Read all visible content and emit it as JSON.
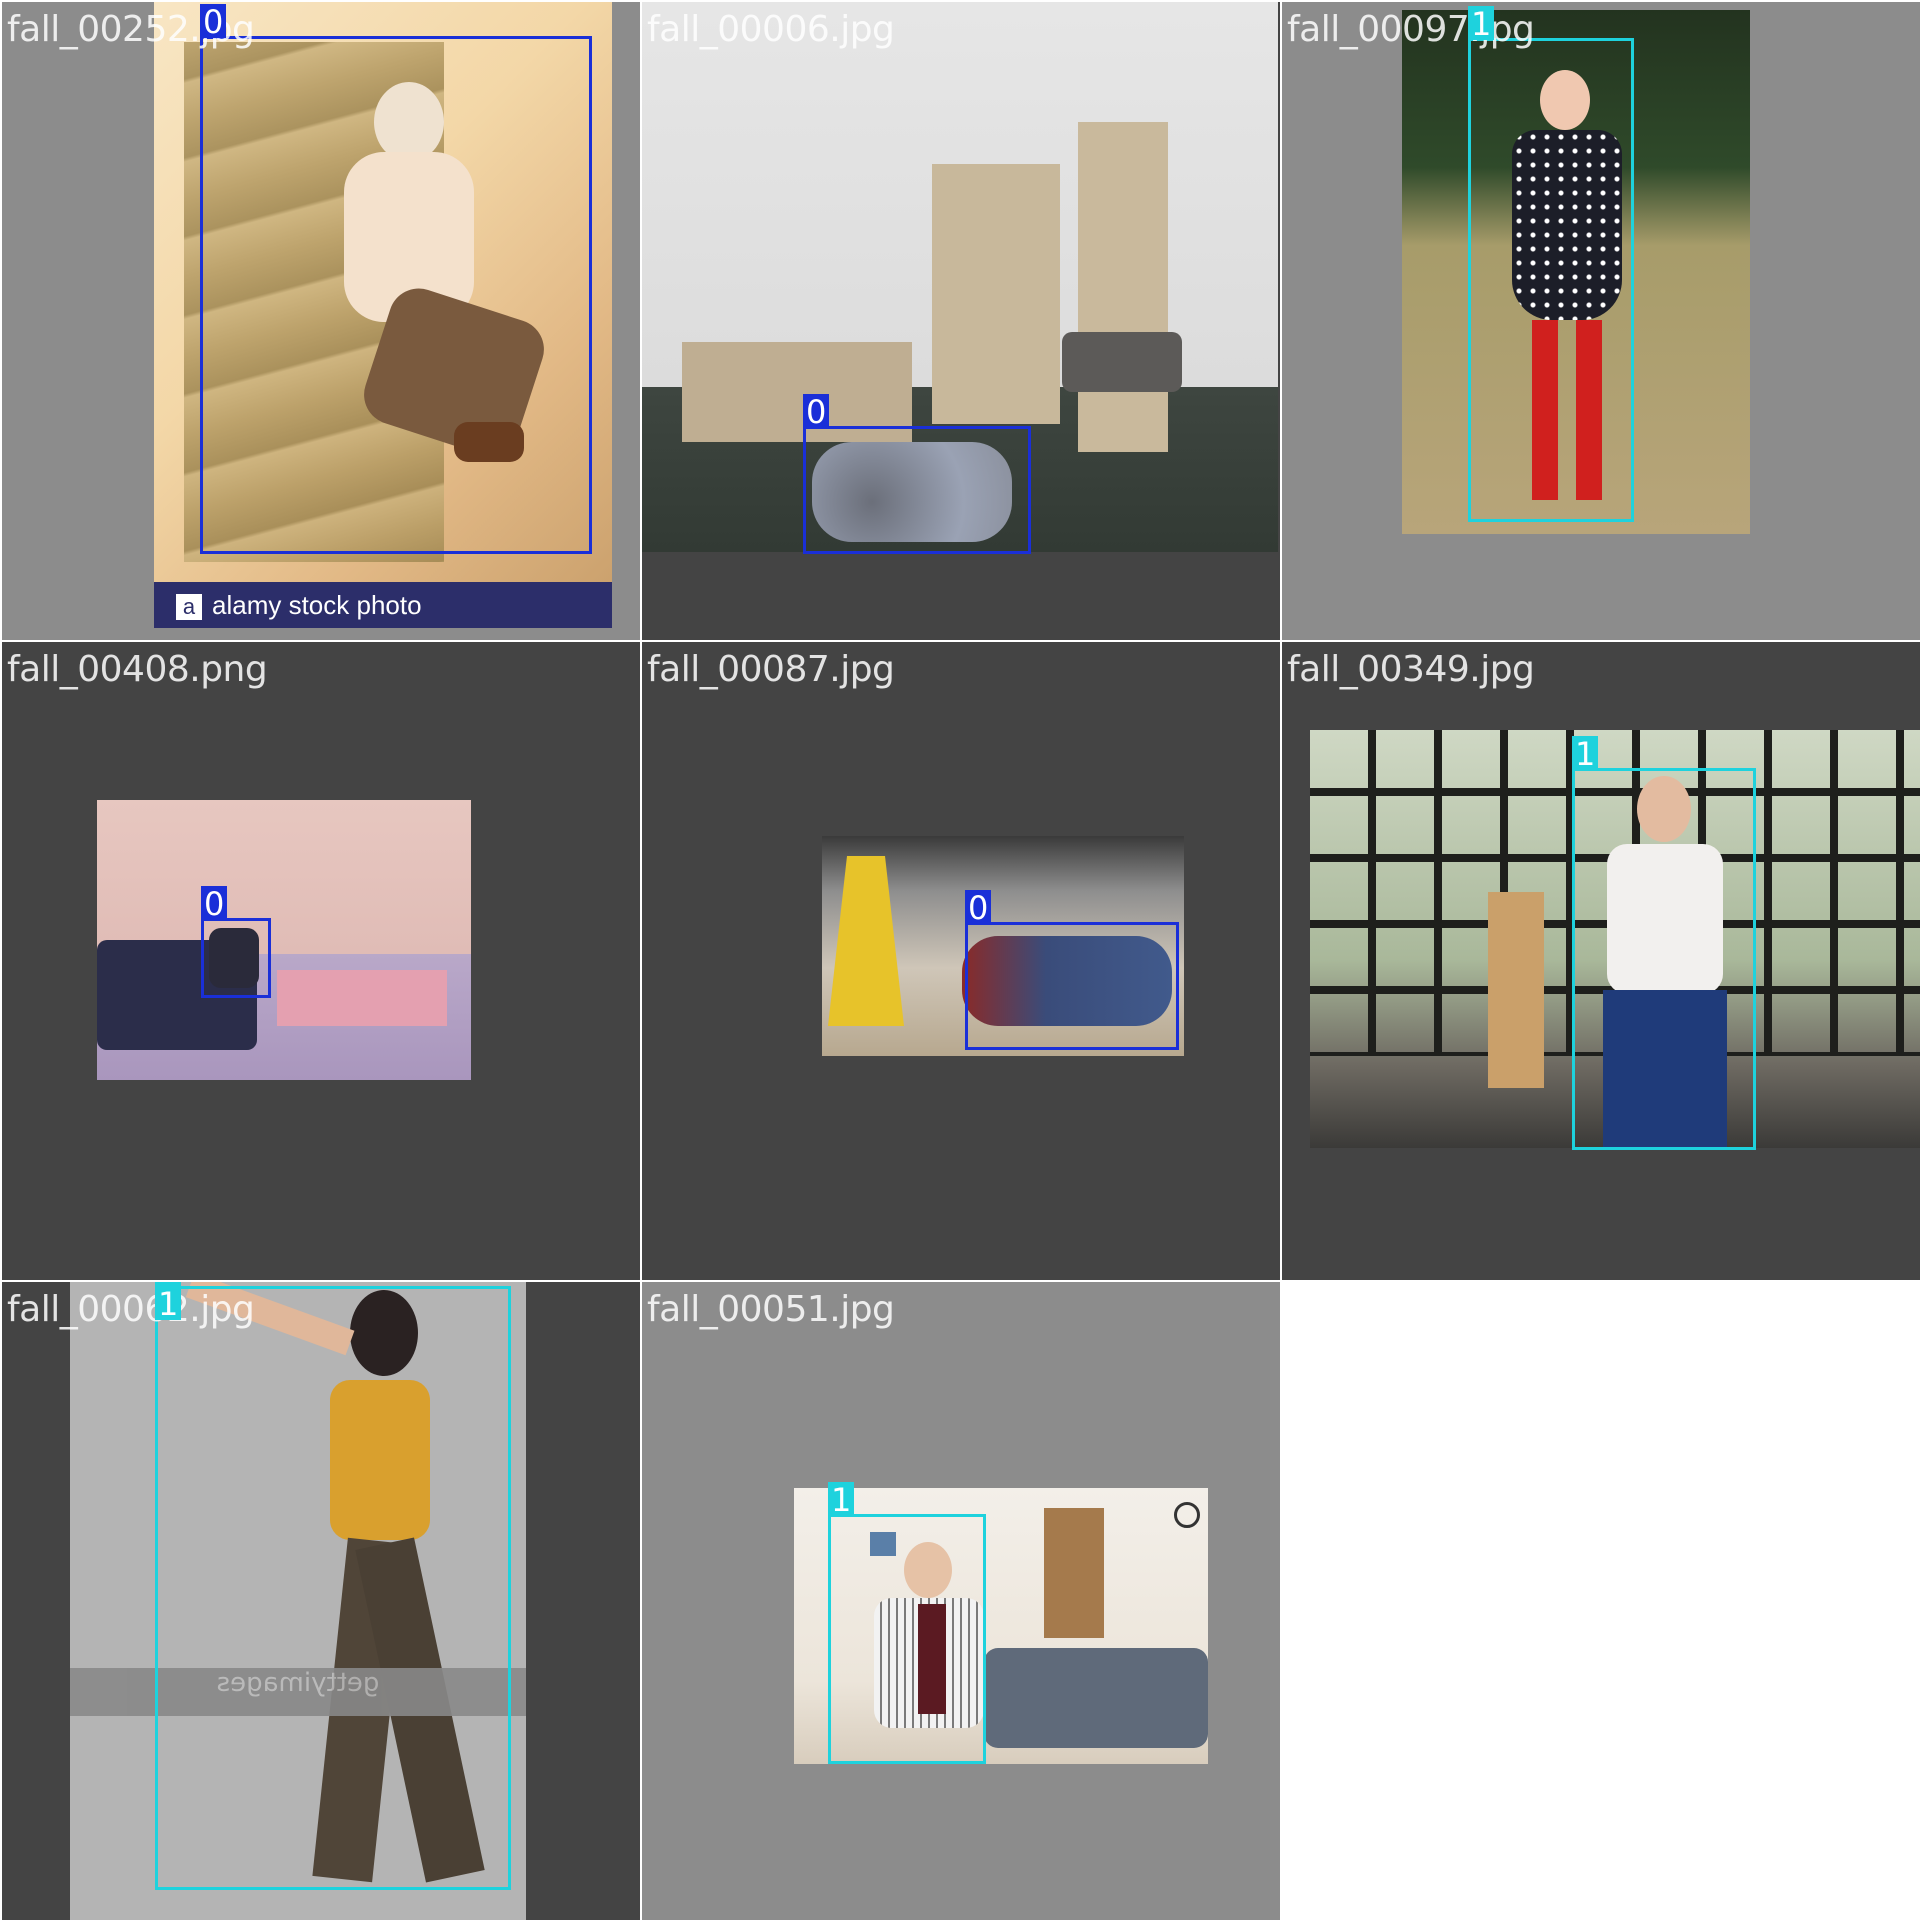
{
  "grid": {
    "tiles": [
      {
        "filename": "fall_00252.jpg",
        "boxes": [
          {
            "class_label": "0"
          }
        ],
        "watermark": "alamy stock photo",
        "watermark_logo": "a"
      },
      {
        "filename": "fall_00006.jpg",
        "boxes": [
          {
            "class_label": "0"
          }
        ]
      },
      {
        "filename": "fall_00097.jpg",
        "boxes": [
          {
            "class_label": "1"
          }
        ]
      },
      {
        "filename": "fall_00408.png",
        "boxes": [
          {
            "class_label": "0"
          }
        ]
      },
      {
        "filename": "fall_00087.jpg",
        "boxes": [
          {
            "class_label": "0"
          }
        ]
      },
      {
        "filename": "fall_00349.jpg",
        "boxes": [
          {
            "class_label": "1"
          }
        ]
      },
      {
        "filename": "fall_00062.jpg",
        "boxes": [
          {
            "class_label": "1"
          }
        ],
        "watermark": "gettyimages"
      },
      {
        "filename": "fall_00051.jpg",
        "boxes": [
          {
            "class_label": "1"
          }
        ]
      }
    ]
  },
  "colors": {
    "class_0_box": "#1a2fd8",
    "class_1_box": "#1ed2dd",
    "tile_gray": "#8c8c8c",
    "tile_dark": "#444444"
  }
}
